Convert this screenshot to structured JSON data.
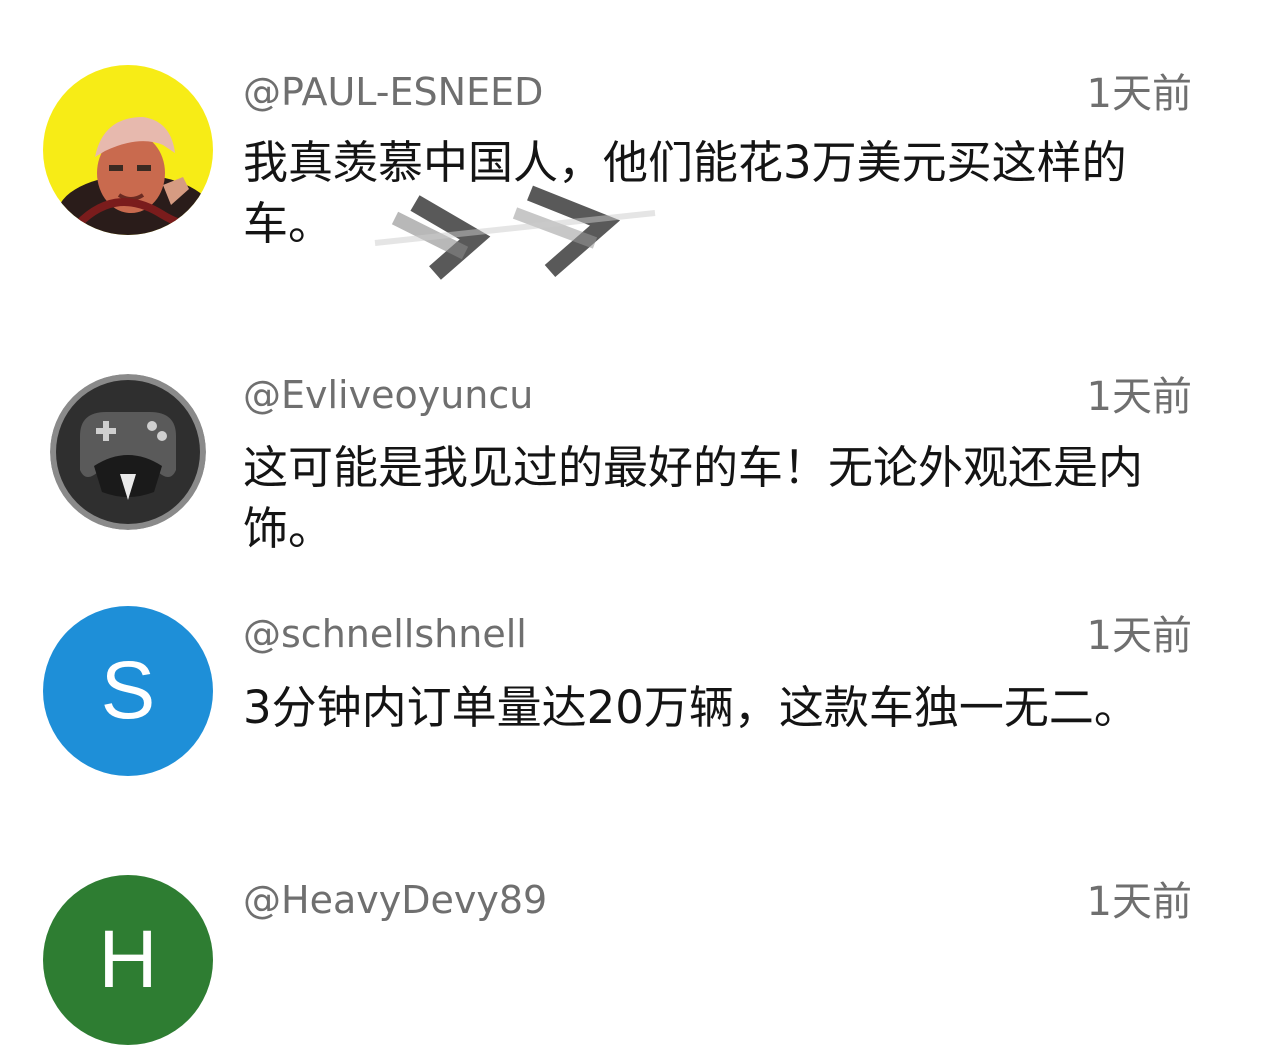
{
  "comments": [
    {
      "username": "@PAUL-ESNEED",
      "time": "1天前",
      "text": "我真羡慕中国人，他们能花3万美元买这样的车。",
      "avatar": {
        "type": "photo",
        "icon": "person-photo-icon",
        "bg": "#f7ec16"
      }
    },
    {
      "username": "@Evliveoyuncu",
      "time": "1天前",
      "text": "这可能是我见过的最好的车！无论外观还是内饰。",
      "avatar": {
        "type": "graphic",
        "icon": "gamepad-mascot-icon",
        "bg": "#3a3a3a"
      }
    },
    {
      "username": "@schnellshnell",
      "time": "1天前",
      "text": "3分钟内订单量达20万辆，这款车独一无二。",
      "avatar": {
        "type": "letter",
        "letter": "S",
        "bg": "#1e8fd8"
      }
    },
    {
      "username": "@HeavyDevy89",
      "time": "1天前",
      "text": "",
      "avatar": {
        "type": "letter",
        "letter": "H",
        "bg": "#2e7d32"
      }
    }
  ]
}
